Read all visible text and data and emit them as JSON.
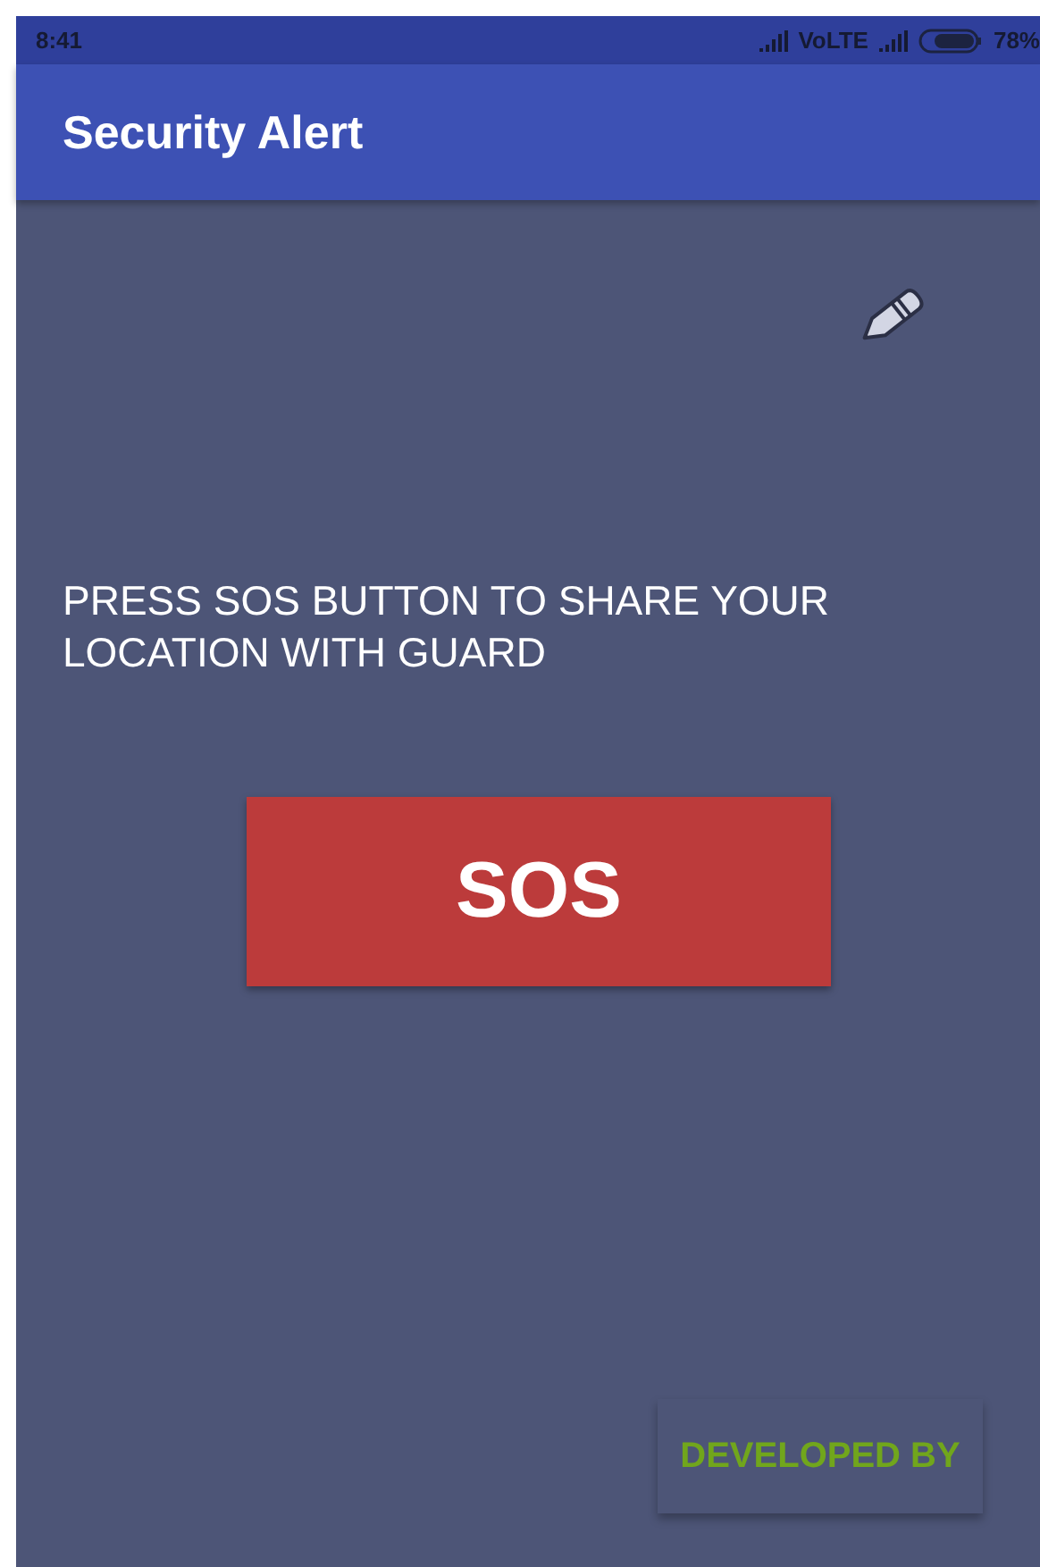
{
  "status_bar": {
    "time": "8:41",
    "network": "VoLTE",
    "battery": "78%"
  },
  "app_bar": {
    "title": "Security Alert"
  },
  "instruction": "PRESS SOS BUTTON TO SHARE YOUR LOCATION WITH GUARD",
  "sos_button": "SOS",
  "developed_button": "DEVELOPED BY"
}
